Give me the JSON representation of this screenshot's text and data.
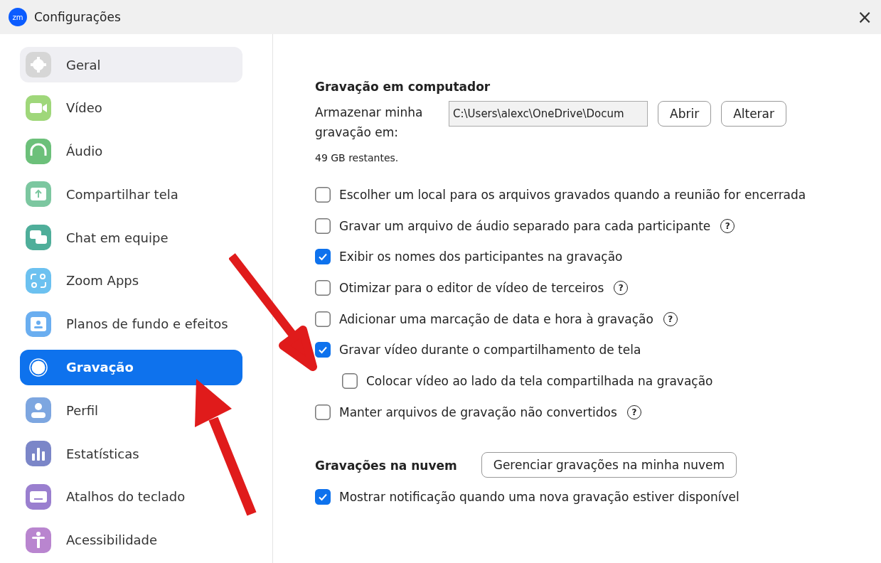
{
  "window": {
    "logo": "zm",
    "title": "Configurações",
    "close": "×"
  },
  "sidebar": {
    "items": [
      {
        "label": "Geral",
        "selected": false,
        "hovered": true
      },
      {
        "label": "Vídeo",
        "selected": false,
        "hovered": false
      },
      {
        "label": "Áudio",
        "selected": false,
        "hovered": false
      },
      {
        "label": "Compartilhar tela",
        "selected": false,
        "hovered": false
      },
      {
        "label": "Chat em equipe",
        "selected": false,
        "hovered": false
      },
      {
        "label": "Zoom Apps",
        "selected": false,
        "hovered": false
      },
      {
        "label": "Planos de fundo e efeitos",
        "selected": false,
        "hovered": false
      },
      {
        "label": "Gravação",
        "selected": true,
        "hovered": false
      },
      {
        "label": "Perfil",
        "selected": false,
        "hovered": false
      },
      {
        "label": "Estatísticas",
        "selected": false,
        "hovered": false
      },
      {
        "label": "Atalhos do teclado",
        "selected": false,
        "hovered": false
      },
      {
        "label": "Acessibilidade",
        "selected": false,
        "hovered": false
      }
    ]
  },
  "local_recording": {
    "heading": "Gravação em computador",
    "location_label": "Armazenar minha gravação em:",
    "path": "C:\\Users\\alexc\\OneDrive\\Docum",
    "buttons": [
      "Abrir",
      "Alterar"
    ],
    "space": "49 GB restantes.",
    "options": [
      {
        "label": "Escolher um local para os arquivos gravados quando a reunião for encerrada",
        "checked": false,
        "help": false
      },
      {
        "label": "Gravar um arquivo de áudio separado para cada participante",
        "checked": false,
        "help": true
      },
      {
        "label": "Exibir os nomes dos participantes na gravação",
        "checked": true,
        "help": false
      },
      {
        "label": "Otimizar para o editor de vídeo de terceiros",
        "checked": false,
        "help": true
      },
      {
        "label": "Adicionar uma marcação de data e hora à gravação",
        "checked": false,
        "help": true
      },
      {
        "label": "Gravar vídeo durante o compartilhamento de tela",
        "checked": true,
        "help": false,
        "children": [
          {
            "label": "Colocar vídeo ao lado da tela compartilhada na gravação",
            "checked": false,
            "help": false
          }
        ]
      },
      {
        "label": "Manter arquivos de gravação não convertidos",
        "checked": false,
        "help": true
      }
    ]
  },
  "cloud_recording": {
    "heading": "Gravações na nuvem",
    "button": "Gerenciar gravações na minha nuvem",
    "options": [
      {
        "label": "Mostrar notificação quando uma nova gravação estiver disponível",
        "checked": true,
        "help": false
      }
    ]
  },
  "help_glyph": "?"
}
